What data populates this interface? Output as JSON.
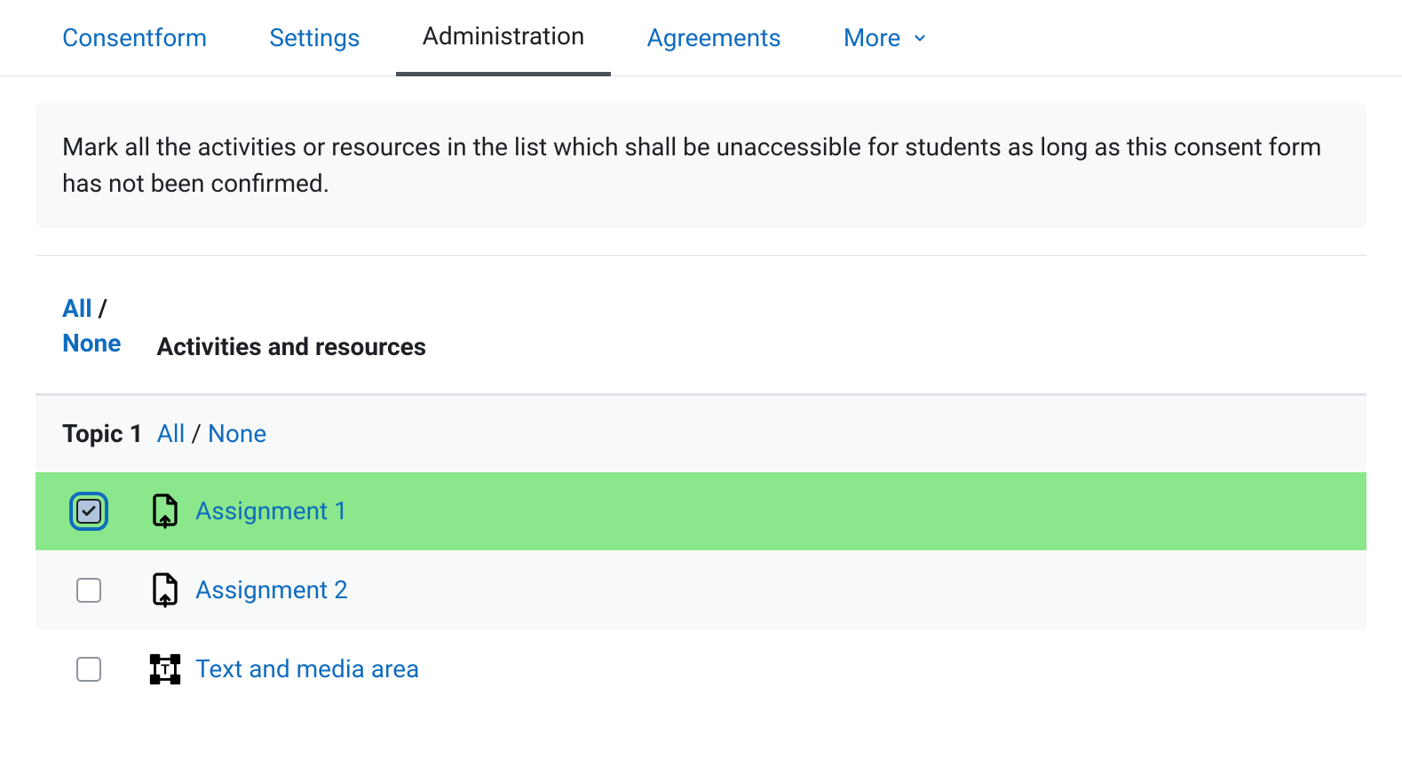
{
  "tabs": {
    "items": [
      {
        "label": "Consentform",
        "active": false
      },
      {
        "label": "Settings",
        "active": false
      },
      {
        "label": "Administration",
        "active": true
      },
      {
        "label": "Agreements",
        "active": false
      },
      {
        "label": "More",
        "active": false,
        "hasDropdown": true
      }
    ]
  },
  "info": {
    "text": "Mark all the activities or resources in the list which shall be unaccessible for students as long as this consent form has not been confirmed."
  },
  "header": {
    "select_all": "All",
    "select_none": "None",
    "separator": "/",
    "column_label": "Activities and resources"
  },
  "topics": [
    {
      "name": "Topic 1",
      "select_all": "All",
      "select_none": "None",
      "separator": "/",
      "activities": [
        {
          "label": "Assignment 1",
          "icon": "assignment",
          "checked": true,
          "focused": true
        },
        {
          "label": "Assignment 2",
          "icon": "assignment",
          "checked": false,
          "focused": false
        },
        {
          "label": "Text and media area",
          "icon": "textmedia",
          "checked": false,
          "focused": false
        }
      ]
    }
  ]
}
